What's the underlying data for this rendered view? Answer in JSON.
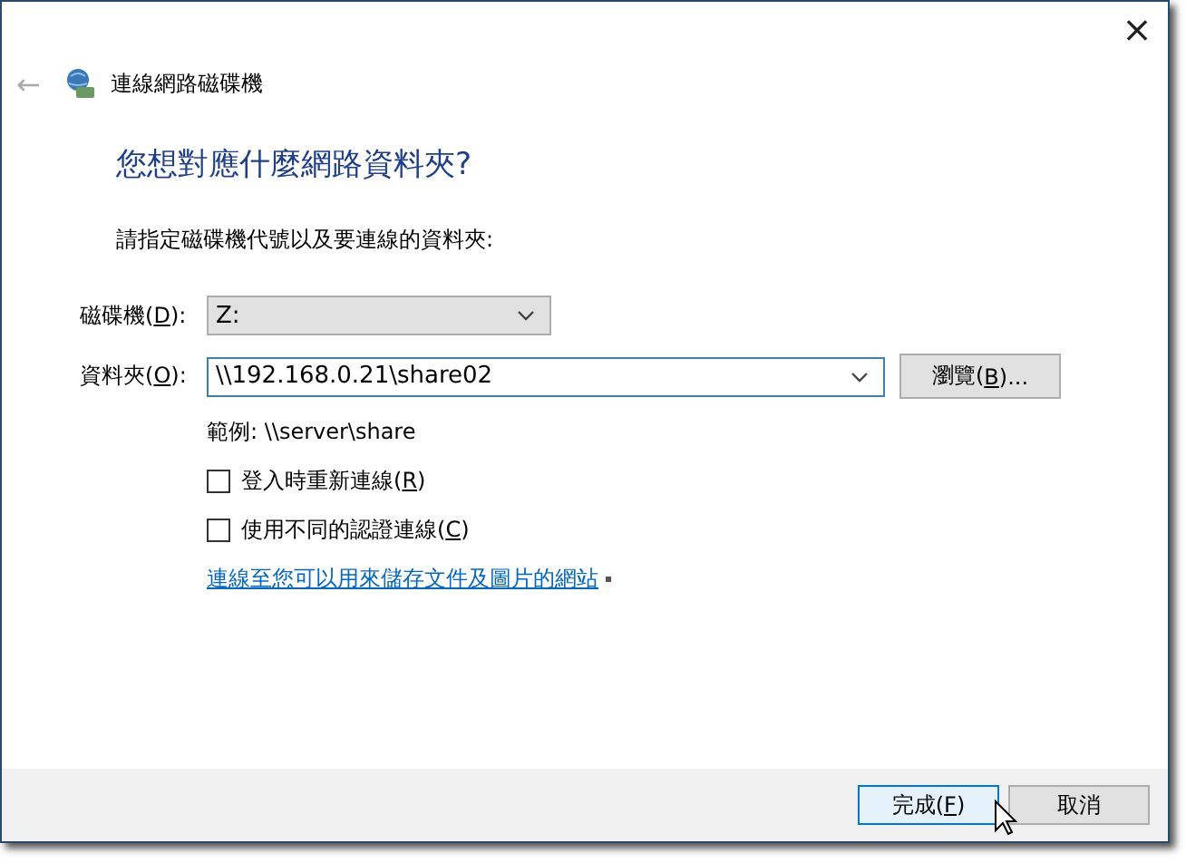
{
  "window": {
    "title": "連線網路磁碟機",
    "close": "×",
    "back": "←"
  },
  "heading": "您想對應什麼網路資料夾?",
  "instruction": "請指定磁碟機代號以及要連線的資料夾:",
  "fields": [
    {
      "kind": "select",
      "label_before": "磁碟機(",
      "access_key": "D",
      "label_after": "):",
      "value": "Z:",
      "focused": false
    },
    {
      "kind": "combo",
      "label_before": "資料夾(",
      "access_key": "O",
      "label_after": "):",
      "value": "\\\\192.168.0.21\\share02",
      "focused": true
    }
  ],
  "browse_button": {
    "label_before": "瀏覽(",
    "access_key": "B",
    "label_after": ")..."
  },
  "example": "範例: \\\\server\\share",
  "checkboxes": [
    {
      "label_before": "登入時重新連線(",
      "access_key": "R",
      "label_after": ")",
      "checked": false
    },
    {
      "label_before": "使用不同的認證連線(",
      "access_key": "C",
      "label_after": ")",
      "checked": false
    }
  ],
  "link": "連線至您可以用來儲存文件及圖片的網站",
  "buttons": [
    {
      "label_before": "完成(",
      "access_key": "F",
      "label_after": ")",
      "default": true
    },
    {
      "label_before": "取消",
      "default": false
    }
  ]
}
